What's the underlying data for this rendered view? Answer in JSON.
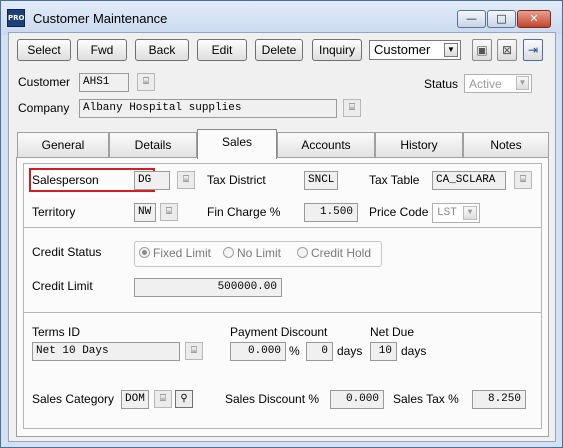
{
  "window": {
    "title": "Customer Maintenance",
    "app_icon": "PRO",
    "controls": {
      "minimize": "—",
      "maximize": "□",
      "close": "✕"
    }
  },
  "toolbar": {
    "select": "Select",
    "fwd": "Fwd",
    "back": "Back",
    "edit": "Edit",
    "delete": "Delete",
    "inquiry": "Inquiry",
    "view_combo": "Customer",
    "icons": [
      "save-icon",
      "cancel-icon",
      "exit-icon"
    ]
  },
  "header": {
    "customer_label": "Customer",
    "customer_value": "AHS1",
    "company_label": "Company",
    "company_value": "Albany Hospital supplies",
    "status_label": "Status",
    "status_value": "Active"
  },
  "tabs": [
    {
      "label": "General"
    },
    {
      "label": "Details"
    },
    {
      "label": "Sales",
      "active": true
    },
    {
      "label": "Accounts"
    },
    {
      "label": "History"
    },
    {
      "label": "Notes"
    }
  ],
  "sales": {
    "salesperson_label": "Salesperson",
    "salesperson_value": "DG",
    "tax_district_label": "Tax District",
    "tax_district_value": "SNCL",
    "tax_table_label": "Tax Table",
    "tax_table_value": "CA_SCLARA",
    "territory_label": "Territory",
    "territory_value": "NW",
    "fin_charge_label": "Fin Charge %",
    "fin_charge_value": "1.500",
    "price_code_label": "Price Code",
    "price_code_value": "LST",
    "credit_status_label": "Credit Status",
    "credit_options": [
      "Fixed Limit",
      "No Limit",
      "Credit Hold"
    ],
    "credit_selected": "Fixed Limit",
    "credit_limit_label": "Credit Limit",
    "credit_limit_value": "500000.00",
    "terms_id_label": "Terms ID",
    "terms_id_value": "Net 10 Days",
    "payment_discount_label": "Payment Discount",
    "payment_discount_value": "0.000",
    "payment_discount_days": "0",
    "net_due_label": "Net Due",
    "net_due_value": "10",
    "percent_sign": "%",
    "days_label": "days",
    "sales_category_label": "Sales Category",
    "sales_category_value": "DOM",
    "sales_discount_label": "Sales Discount %",
    "sales_discount_value": "0.000",
    "sales_tax_label": "Sales Tax %",
    "sales_tax_value": "8.250"
  },
  "colors": {
    "window_frame": "#d4e1f1",
    "highlight": "#d11f1f",
    "close_button": "#c4442c"
  }
}
